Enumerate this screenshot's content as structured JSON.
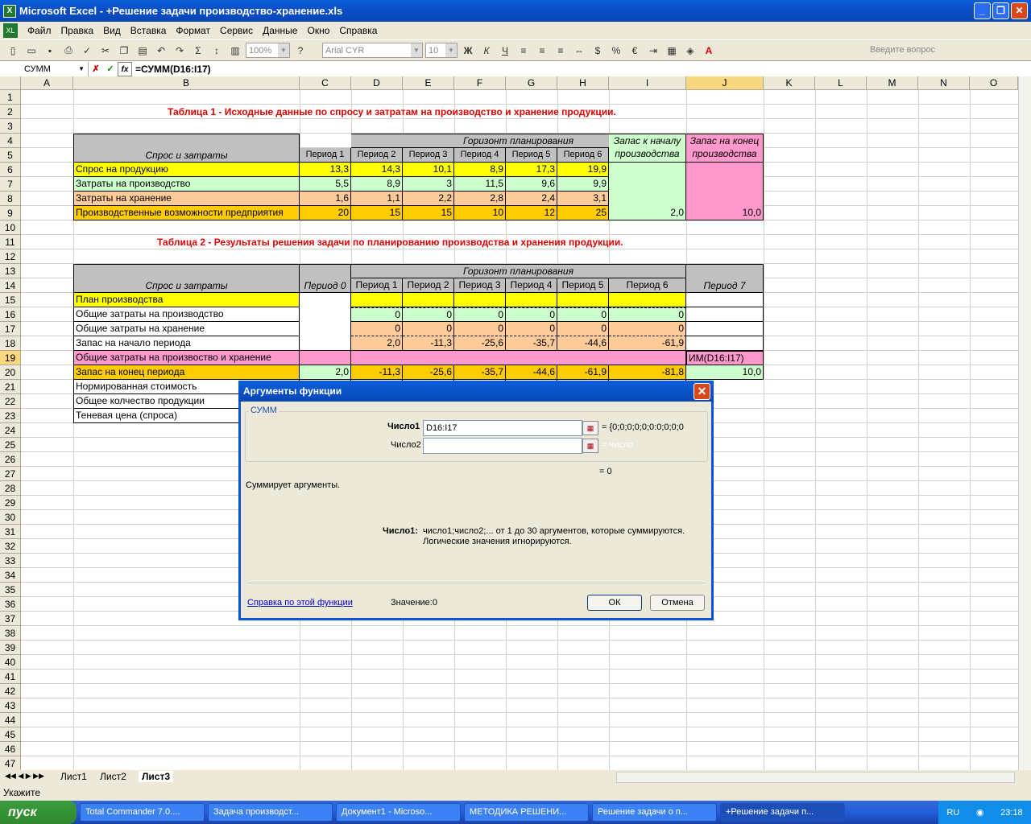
{
  "window": {
    "title": "Microsoft Excel - +Решение задачи производство-хранение.xls"
  },
  "menu": [
    "Файл",
    "Правка",
    "Вид",
    "Вставка",
    "Формат",
    "Сервис",
    "Данные",
    "Окно",
    "Справка"
  ],
  "ask": "Введите вопрос",
  "toolbar": {
    "zoom": "100%",
    "font": "Arial CYR",
    "size": "10"
  },
  "formula": {
    "namebox": "СУММ",
    "text": "=СУММ(D16:I17)"
  },
  "columns": [
    "A",
    "B",
    "C",
    "D",
    "E",
    "F",
    "G",
    "H",
    "I",
    "J",
    "K",
    "L",
    "M",
    "N",
    "O"
  ],
  "table1": {
    "title": "Таблица 1 - Исходные данные по спросу и затратам на производство и хранение продукции.",
    "horizon": "Горизонт планирования",
    "rowhead": "Спрос и затраты",
    "periods": [
      "Период 1",
      "Период 2",
      "Период 3",
      "Период 4",
      "Период 5",
      "Период 6"
    ],
    "stock_start": "Запас к началу производства",
    "stock_end": "Запас на конец производства",
    "rows": [
      {
        "label": "Спрос на продукцию",
        "vals": [
          "13,3",
          "14,3",
          "10,1",
          "8,9",
          "17,3",
          "19,9"
        ]
      },
      {
        "label": "Затраты на производство",
        "vals": [
          "5,5",
          "8,9",
          "3",
          "11,5",
          "9,6",
          "9,9"
        ]
      },
      {
        "label": "Затраты на хранение",
        "vals": [
          "1,6",
          "1,1",
          "2,2",
          "2,8",
          "2,4",
          "3,1"
        ]
      },
      {
        "label": "Производственные возможности предприятия",
        "vals": [
          "20",
          "15",
          "15",
          "10",
          "12",
          "25"
        ]
      }
    ],
    "start_val": "2,0",
    "end_val": "10,0"
  },
  "table2": {
    "title": "Таблица 2 - Результаты решения задачи по планированию производства и хранения продукции.",
    "horizon": "Горизонт планирования",
    "rowhead": "Спрос и затраты",
    "period0": "Период 0",
    "period7": "Период 7",
    "periods": [
      "Период 1",
      "Период 2",
      "Период 3",
      "Период 4",
      "Период 5",
      "Период 6"
    ],
    "labels": [
      "План производства",
      "Общие  затраты на производство",
      "Общие  затраты на хранение",
      "Запас на начало периода",
      "Общие затраты на произвоство и хранение",
      "Запас на конец периода",
      "Нормированная стоимость",
      "Общее колчество продукции",
      "Теневая цена (спроса)"
    ],
    "prod_costs": [
      "0",
      "0",
      "0",
      "0",
      "0",
      "0"
    ],
    "store_costs": [
      "0",
      "0",
      "0",
      "0",
      "0",
      "0"
    ],
    "start_stock": [
      "2,0",
      "-11,3",
      "-25,6",
      "-35,7",
      "-44,6",
      "-61,9"
    ],
    "end_stock": [
      "-11,3",
      "-25,6",
      "-35,7",
      "-44,6",
      "-61,9",
      "-81,8"
    ],
    "p0_end": "2,0",
    "p7_end": "10,0",
    "j19": "ИМ(D16:I17)"
  },
  "dialog": {
    "title": "Аргументы функции",
    "func": "СУММ",
    "arg1_label": "Число1",
    "arg1_value": "D16:I17",
    "arg1_result": "{0;0;0;0;0;0:0;0;0;0",
    "arg2_label": "Число2",
    "arg2_result": "= число",
    "total": "= 0",
    "desc": "Суммирует аргументы.",
    "help_label": "Число1:",
    "help_text": "число1;число2;... от 1 до 30 аргументов, которые суммируются.",
    "help_text2": "Логические значения игнорируются.",
    "help_link": "Справка по этой функции",
    "value_label": "Значение:",
    "value": "0",
    "ok": "ОК",
    "cancel": "Отмена"
  },
  "sheets": [
    "Лист1",
    "Лист2",
    "Лист3"
  ],
  "status": "Укажите",
  "taskbar": {
    "start": "пуск",
    "tasks": [
      "Total Commander 7.0....",
      "Задача производст...",
      "Документ1 - Microso...",
      "МЕТОДИКА РЕШЕНИ...",
      "Решение задачи о п...",
      "+Решение задачи п..."
    ],
    "lang": "RU",
    "clock": "23:18"
  },
  "colors": {
    "yellow": "#ffff00",
    "green": "#ccffcc",
    "peach": "#ffcc99",
    "orange": "#ffcc00",
    "pink": "#ff99cc",
    "gray": "#c0c0c0"
  }
}
